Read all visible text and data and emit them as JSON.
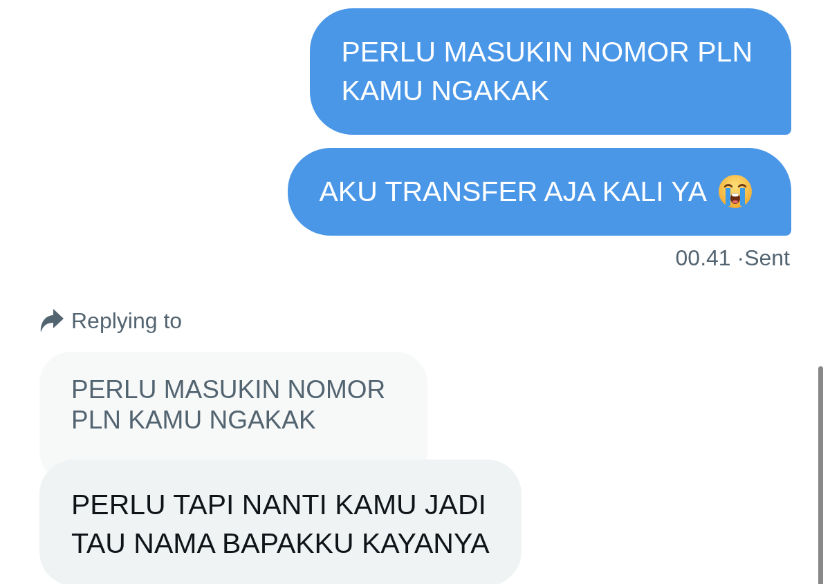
{
  "sent_messages": [
    {
      "lines": [
        "PERLU MASUKIN NOMOR PLN",
        "KAMU NGAKAK"
      ],
      "trailing_emoji": false
    },
    {
      "lines": [
        "AKU TRANSFER AJA KALI YA"
      ],
      "trailing_emoji": true
    }
  ],
  "status": "00.41 ·Sent",
  "reply": {
    "label": "Replying to",
    "quoted_lines": [
      "PERLU MASUKIN NOMOR",
      "PLN KAMU NGAKAK"
    ],
    "lines": [
      "PERLU TAPI NANTI KAMU JADI",
      "TAU NAMA BAPAKKU KAYANYA"
    ]
  }
}
